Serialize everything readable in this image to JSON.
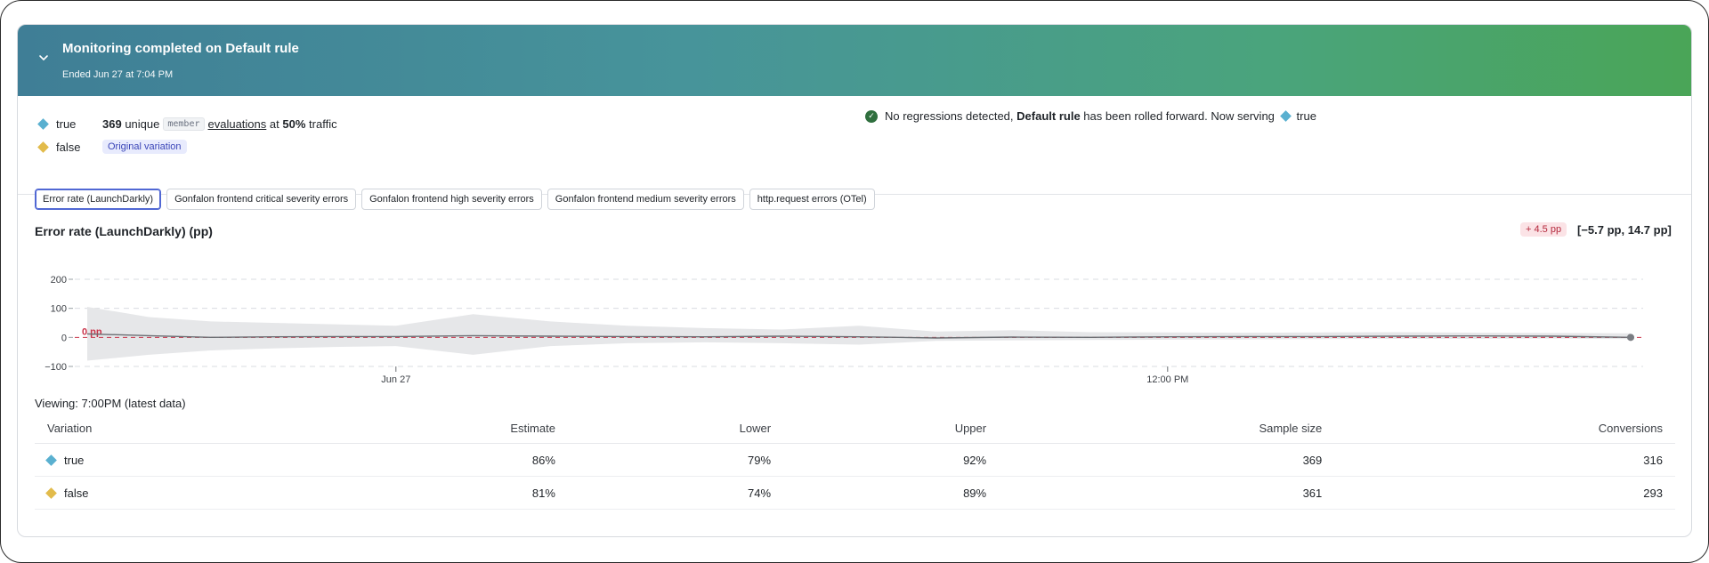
{
  "banner": {
    "title": "Monitoring completed on Default rule",
    "subtitle": "Ended Jun 27 at 7:04 PM"
  },
  "summary": {
    "variations": [
      {
        "name": "true",
        "color": "#5ab0d0"
      },
      {
        "name": "false",
        "color": "#e2bb4b"
      }
    ],
    "count": "369",
    "unique_text": "unique",
    "context_tag": "member",
    "evaluations_text": "evaluations",
    "at_text": "at",
    "traffic_pct": "50%",
    "traffic_text": "traffic",
    "original_tag": "Original variation",
    "status": {
      "lead": "No regressions detected,",
      "rule": "Default rule",
      "rest": "has been rolled forward. Now serving",
      "serving": "true"
    }
  },
  "tabs": [
    {
      "label": "Error rate (LaunchDarkly)",
      "active": true
    },
    {
      "label": "Gonfalon frontend critical severity errors",
      "active": false
    },
    {
      "label": "Gonfalon frontend high severity errors",
      "active": false
    },
    {
      "label": "Gonfalon frontend medium severity errors",
      "active": false
    },
    {
      "label": "http.request errors (OTel)",
      "active": false
    }
  ],
  "metric": {
    "title": "Error rate (LaunchDarkly) (pp)",
    "delta": "+ 4.5 pp",
    "interval": "[−5.7 pp, 14.7 pp]"
  },
  "chart_data": {
    "type": "area",
    "yticks": [
      "200",
      "100",
      "0",
      "−100"
    ],
    "ylim": [
      -100,
      200
    ],
    "xticks": [
      {
        "label": "Jun 27",
        "t": 0.2
      },
      {
        "label": "12:00 PM",
        "t": 0.7
      }
    ],
    "zero_label": "0 pp",
    "grid": true,
    "x": [
      0,
      0.04,
      0.08,
      0.12,
      0.16,
      0.2,
      0.25,
      0.3,
      0.35,
      0.4,
      0.45,
      0.5,
      0.55,
      0.6,
      0.65,
      0.7,
      0.75,
      0.8,
      0.85,
      0.9,
      0.95,
      1.0
    ],
    "estimate": [
      12,
      6,
      0,
      2,
      3,
      3,
      6,
      4,
      3,
      2,
      4,
      2,
      -2,
      1,
      0,
      2,
      3,
      3,
      4,
      5,
      4,
      0
    ],
    "upper": [
      105,
      70,
      55,
      50,
      45,
      40,
      80,
      55,
      40,
      32,
      27,
      40,
      20,
      25,
      18,
      17,
      16,
      17,
      18,
      16,
      15,
      14
    ],
    "lower": [
      -80,
      -60,
      -45,
      -38,
      -33,
      -30,
      -60,
      -30,
      -20,
      -17,
      -20,
      -25,
      -12,
      -10,
      -9,
      -8,
      -7,
      -6,
      -5,
      -5,
      -4,
      -6
    ]
  },
  "viewing": "Viewing: 7:00PM (latest data)",
  "table": {
    "headers": [
      "Variation",
      "Estimate",
      "Lower",
      "Upper",
      "Sample size",
      "Conversions"
    ],
    "rows": [
      {
        "variation": "true",
        "color": "#5ab0d0",
        "estimate": "86%",
        "lower": "79%",
        "upper": "92%",
        "sample": "369",
        "conversions": "316"
      },
      {
        "variation": "false",
        "color": "#e2bb4b",
        "estimate": "81%",
        "lower": "74%",
        "upper": "89%",
        "sample": "361",
        "conversions": "293"
      }
    ]
  }
}
